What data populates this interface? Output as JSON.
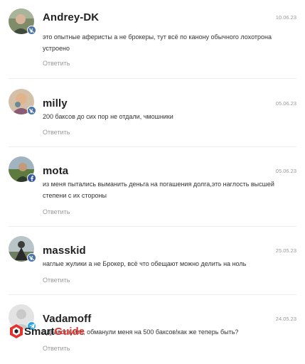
{
  "comments": [
    {
      "author": "Andrey-DK",
      "date": "10.06.23",
      "text": "это опытные аферисты а не брокеры, тут всё по канону обычного лохотрона устроено",
      "reply_label": "Ответить",
      "badge_icon": "vk-icon",
      "badge_color": "#4a76a8"
    },
    {
      "author": "milly",
      "date": "05.06.23",
      "text": "200 баксов до сих пор не отдали, чмошники",
      "reply_label": "Ответить",
      "badge_icon": "vk-icon",
      "badge_color": "#4a76a8"
    },
    {
      "author": "mota",
      "date": "05.06.23",
      "text": "из меня пытались выманить деньга на погашения долга,это наглость высшей степени с их стороны",
      "reply_label": "Ответить",
      "badge_icon": "facebook-icon",
      "badge_color": "#3b5998"
    },
    {
      "author": "masskid",
      "date": "25.05.23",
      "text": "наглые жулики а не Брокер, всё что обещают можно делить на ноль",
      "reply_label": "Ответить",
      "badge_icon": "vk-icon",
      "badge_color": "#4a76a8"
    },
    {
      "author": "Vadamoff",
      "date": "24.05.23",
      "text": "Здравствуйте, обманули меня на 500 баксов!как же теперь быть?",
      "reply_label": "Ответить",
      "badge_icon": "telegram-icon",
      "badge_color": "#2ca5e0"
    }
  ],
  "watermark": {
    "part1": "Smart",
    "part2": "Guide",
    "color1": "#222222",
    "color2": "#e5322d"
  }
}
